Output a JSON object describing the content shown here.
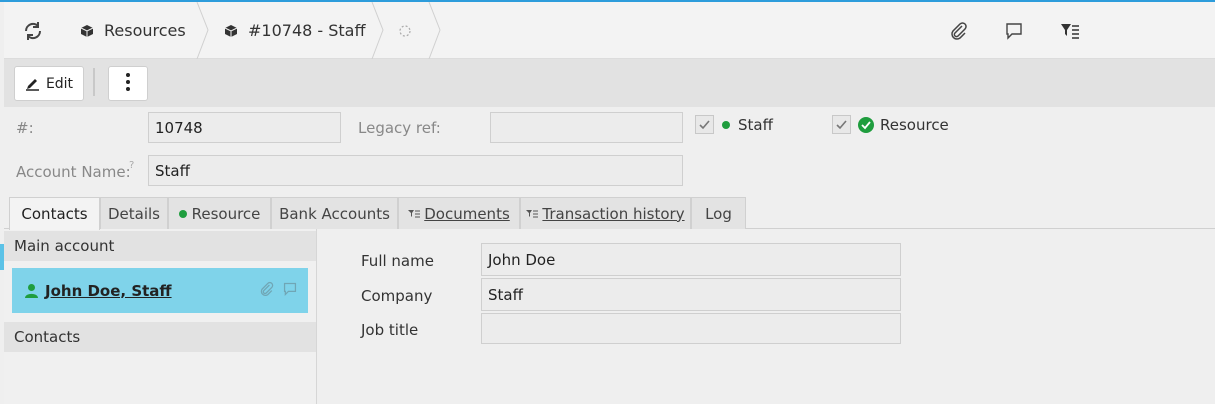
{
  "header": {
    "breadcrumbs": [
      {
        "label": "Resources",
        "icon": "cube-icon"
      },
      {
        "label": "#10748 - Staff",
        "icon": "cube-icon"
      }
    ]
  },
  "toolbar": {
    "edit_label": "Edit"
  },
  "form": {
    "number_label": "#:",
    "number_value": "10748",
    "legacy_label": "Legacy ref:",
    "legacy_value": "",
    "account_label": "Account Name:",
    "account_help": "?",
    "account_value": "Staff",
    "staff_label": "Staff",
    "resource_label": "Resource"
  },
  "tabs": [
    {
      "label": "Contacts"
    },
    {
      "label": "Details"
    },
    {
      "label": "Resource"
    },
    {
      "label": "Bank Accounts"
    },
    {
      "label": "Documents"
    },
    {
      "label": "Transaction history"
    },
    {
      "label": "Log"
    }
  ],
  "left_panel": {
    "main_account_title": "Main account",
    "main_contact": "John Doe, Staff",
    "contacts_title": "Contacts"
  },
  "detail": {
    "full_name_label": "Full name",
    "full_name_value": "John Doe",
    "company_label": "Company",
    "company_value": "Staff",
    "job_title_label": "Job title",
    "job_title_value": ""
  },
  "colors": {
    "accent": "#2d9cdb",
    "selected": "#7fd3ea",
    "status_green": "#1f9d3e"
  }
}
